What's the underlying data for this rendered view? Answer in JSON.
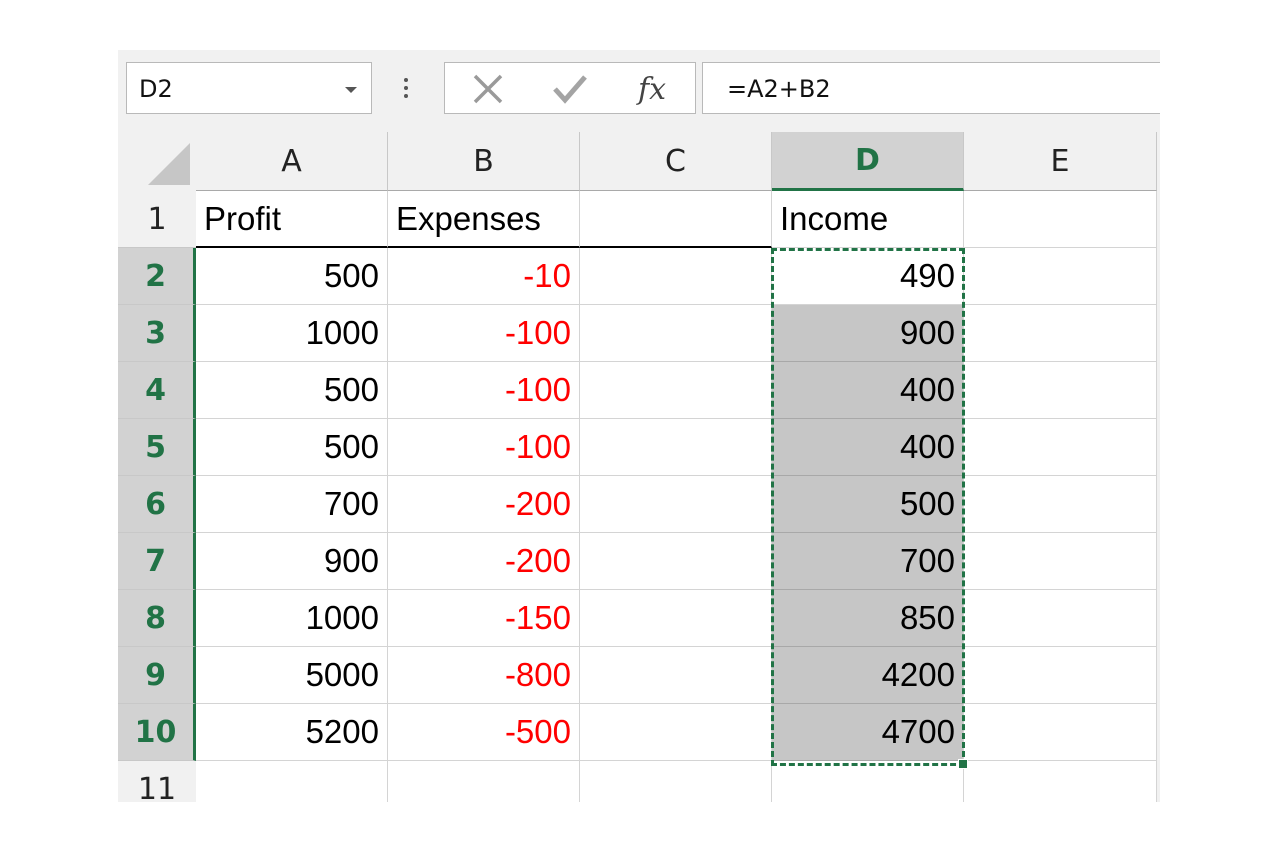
{
  "formula_bar": {
    "name_box": "D2",
    "formula": "=A2+B2",
    "icons": {
      "name_box_dropdown": "chevron-down-icon",
      "more": "vertical-dots-icon",
      "cancel": "x-icon",
      "enter": "checkmark-icon",
      "function": "fx-icon"
    },
    "fx_label": "fx"
  },
  "sheet": {
    "columns": [
      "A",
      "B",
      "C",
      "D",
      "E"
    ],
    "active_column": "D",
    "rows": [
      {
        "num": "1",
        "cells": {
          "A": "Profit",
          "B": "Expenses",
          "C": "",
          "D": "Income",
          "E": ""
        }
      },
      {
        "num": "2",
        "cells": {
          "A": "500",
          "B": "-10",
          "C": "",
          "D": "490",
          "E": ""
        }
      },
      {
        "num": "3",
        "cells": {
          "A": "1000",
          "B": "-100",
          "C": "",
          "D": "900",
          "E": ""
        }
      },
      {
        "num": "4",
        "cells": {
          "A": "500",
          "B": "-100",
          "C": "",
          "D": "400",
          "E": ""
        }
      },
      {
        "num": "5",
        "cells": {
          "A": "500",
          "B": "-100",
          "C": "",
          "D": "400",
          "E": ""
        }
      },
      {
        "num": "6",
        "cells": {
          "A": "700",
          "B": "-200",
          "C": "",
          "D": "500",
          "E": ""
        }
      },
      {
        "num": "7",
        "cells": {
          "A": "900",
          "B": "-200",
          "C": "",
          "D": "700",
          "E": ""
        }
      },
      {
        "num": "8",
        "cells": {
          "A": "1000",
          "B": "-150",
          "C": "",
          "D": "850",
          "E": ""
        }
      },
      {
        "num": "9",
        "cells": {
          "A": "5000",
          "B": "-800",
          "C": "",
          "D": "4200",
          "E": ""
        }
      },
      {
        "num": "10",
        "cells": {
          "A": "5200",
          "B": "-500",
          "C": "",
          "D": "4700",
          "E": ""
        }
      },
      {
        "num": "11",
        "cells": {
          "A": "",
          "B": "",
          "C": "",
          "D": "",
          "E": ""
        }
      }
    ],
    "active_cell": "D2",
    "selection": "D2:D10",
    "active_rows": [
      "2",
      "3",
      "4",
      "5",
      "6",
      "7",
      "8",
      "9",
      "10"
    ],
    "colors": {
      "accent": "#217346",
      "negative": "#ff0000",
      "selection_fill": "#c6c6c6",
      "header_fill": "#f1f1f1"
    }
  }
}
